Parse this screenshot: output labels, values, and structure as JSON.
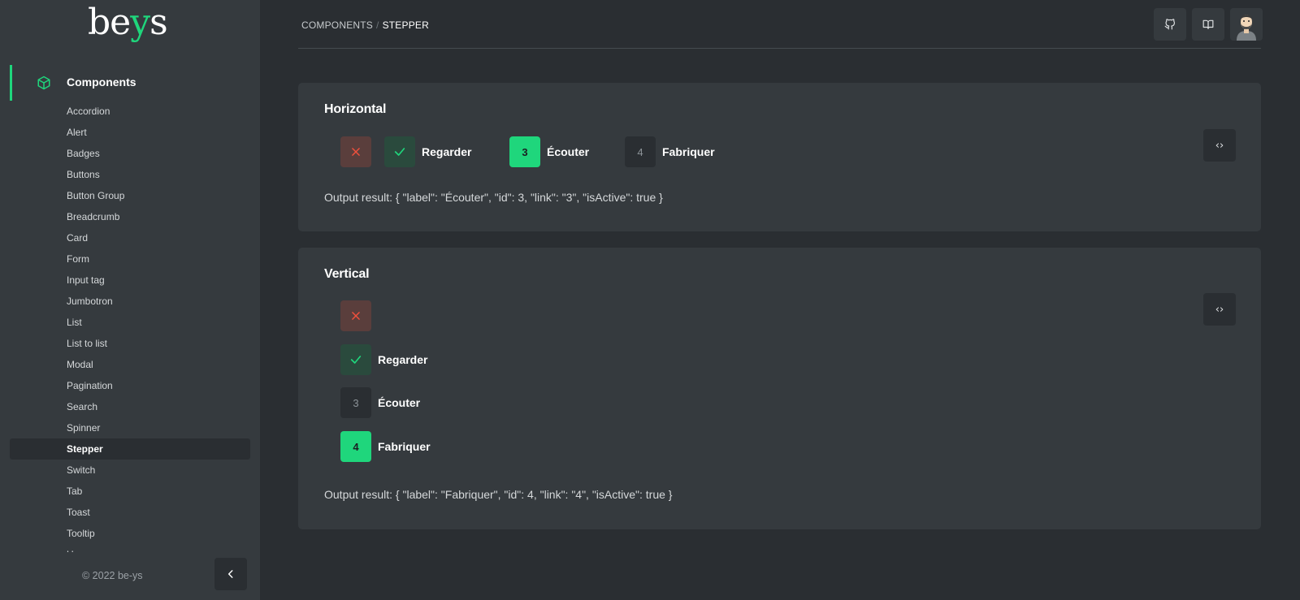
{
  "brand": {
    "logo_pre": "be",
    "logo_accent": "y",
    "logo_post": "s",
    "accent_color": "#1fd67c"
  },
  "sidebar": {
    "section_title": "Components",
    "items": [
      {
        "label": "Accordion"
      },
      {
        "label": "Alert"
      },
      {
        "label": "Badges"
      },
      {
        "label": "Buttons"
      },
      {
        "label": "Button Group"
      },
      {
        "label": "Breadcrumb"
      },
      {
        "label": "Card"
      },
      {
        "label": "Form"
      },
      {
        "label": "Input tag"
      },
      {
        "label": "Jumbotron"
      },
      {
        "label": "List"
      },
      {
        "label": "List to list"
      },
      {
        "label": "Modal"
      },
      {
        "label": "Pagination"
      },
      {
        "label": "Search"
      },
      {
        "label": "Spinner"
      },
      {
        "label": "Stepper",
        "active": true
      },
      {
        "label": "Switch"
      },
      {
        "label": "Tab"
      },
      {
        "label": "Toast"
      },
      {
        "label": "Tooltip"
      },
      {
        "label": "Uses"
      }
    ],
    "copyright": "© 2022 be-ys"
  },
  "header": {
    "breadcrumb": [
      "COMPONENTS",
      "STEPPER"
    ],
    "separator": "/",
    "icons": [
      "github-icon",
      "book-icon",
      "avatar"
    ]
  },
  "horizontal": {
    "title": "Horizontal",
    "steps": [
      {
        "status": "error",
        "label": ""
      },
      {
        "status": "done",
        "label": "Regarder"
      },
      {
        "status": "active",
        "number": "3",
        "label": "Écouter"
      },
      {
        "status": "todo",
        "number": "4",
        "label": "Fabriquer"
      }
    ],
    "output": "Output result: { \"label\": \"Écouter\", \"id\": 3, \"link\": \"3\", \"isActive\": true }"
  },
  "vertical": {
    "title": "Vertical",
    "steps": [
      {
        "status": "error",
        "label": ""
      },
      {
        "status": "done",
        "label": "Regarder"
      },
      {
        "status": "todo",
        "number": "3",
        "label": "Écouter"
      },
      {
        "status": "active",
        "number": "4",
        "label": "Fabriquer"
      }
    ],
    "output": "Output result: { \"label\": \"Fabriquer\", \"id\": 4, \"link\": \"4\", \"isActive\": true }"
  },
  "code_button_glyph": "‹›"
}
